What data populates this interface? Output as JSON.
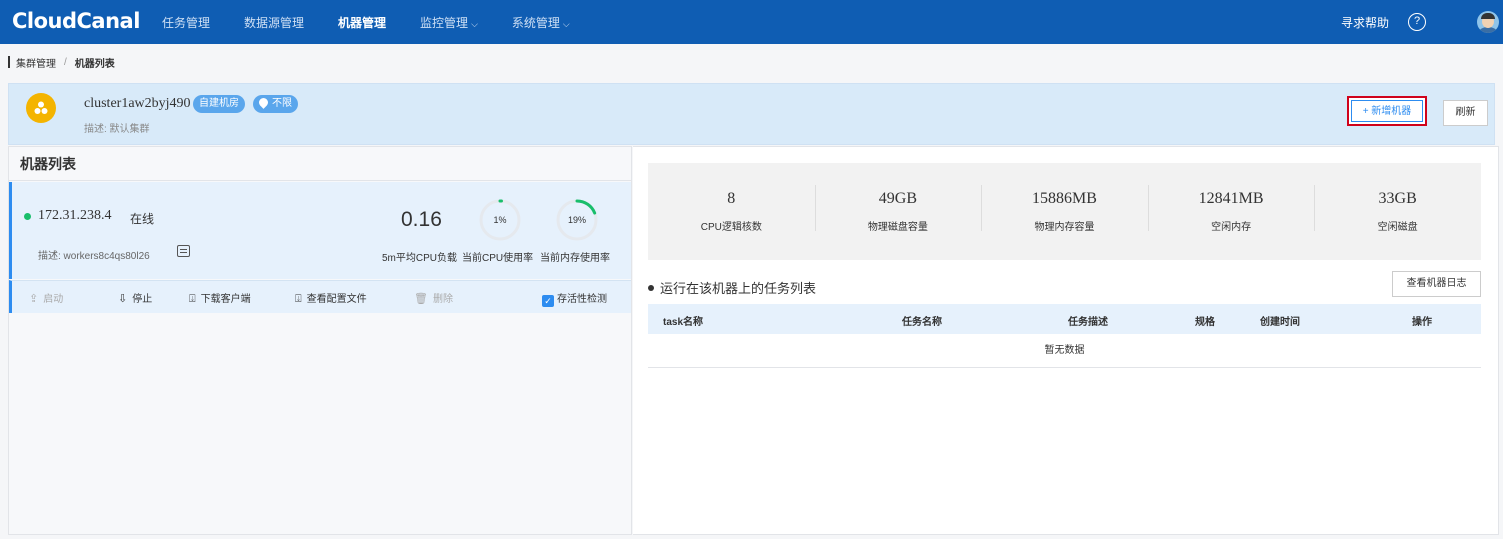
{
  "topbar": {
    "logo": "CloudCanal",
    "nav": [
      {
        "label": "任务管理",
        "active": false,
        "dropdown": false
      },
      {
        "label": "数据源管理",
        "active": false,
        "dropdown": false
      },
      {
        "label": "机器管理",
        "active": true,
        "dropdown": false
      },
      {
        "label": "监控管理",
        "active": false,
        "dropdown": true
      },
      {
        "label": "系统管理",
        "active": false,
        "dropdown": true
      }
    ],
    "help_label": "寻求帮助",
    "help_icon": "?",
    "color": "#0f5db3"
  },
  "breadcrumb": {
    "parent": "集群管理",
    "separator": "/",
    "current": "机器列表"
  },
  "cluster": {
    "name": "cluster1aw2byj490",
    "tag_type": "自建机房",
    "tag_region": "不限",
    "desc": "描述: 默认集群",
    "add_button": "+ 新增机器",
    "refresh_button": "刷新"
  },
  "machine_list": {
    "title": "机器列表",
    "machines": [
      {
        "ip": "172.31.238.4",
        "status": "在线",
        "desc": "描述: workers8c4qs80l26",
        "cpu_load": "0.16",
        "cpu_load_label": "5m平均CPU负载",
        "cpu_usage": "1%",
        "cpu_usage_value": 0.01,
        "cpu_usage_label": "当前CPU使用率",
        "mem_usage": "19%",
        "mem_usage_value": 0.19,
        "mem_usage_label": "当前内存使用率"
      }
    ],
    "actions": {
      "start": "启动",
      "stop": "停止",
      "download": "下载客户端",
      "view_config": "查看配置文件",
      "delete": "删除",
      "liveness": "存活性检测"
    }
  },
  "stats": [
    {
      "value": "8",
      "label": "CPU逻辑核数"
    },
    {
      "value": "49GB",
      "label": "物理磁盘容量"
    },
    {
      "value": "15886MB",
      "label": "物理内存容量"
    },
    {
      "value": "12841MB",
      "label": "空闲内存"
    },
    {
      "value": "33GB",
      "label": "空闲磁盘"
    }
  ],
  "tasks": {
    "title": "运行在该机器上的任务列表",
    "log_button": "查看机器日志",
    "columns": [
      "task名称",
      "任务名称",
      "任务描述",
      "规格",
      "创建时间",
      "操作"
    ],
    "empty_text": "暂无数据"
  }
}
